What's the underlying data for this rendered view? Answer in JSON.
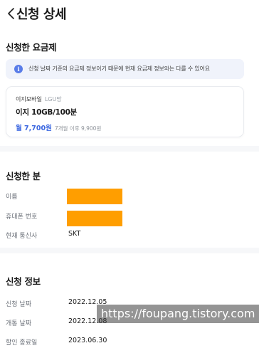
{
  "header": {
    "back_icon": "chevron-left-icon",
    "title": "신청 상세"
  },
  "plan_section": {
    "title": "신청한 요금제",
    "notice": {
      "icon": "info-icon",
      "icon_glyph": "i",
      "text": "신청 날짜 기준의 요금제 정보이기 때문에 현재 요금제 정보와는 다를 수 있어요"
    },
    "card": {
      "carrier": "이지모바일",
      "network": "LGU망",
      "plan_name": "이지 10GB/100분",
      "price": "월 7,700원",
      "after_price": "7개월 이후 9,900원"
    }
  },
  "applicant_section": {
    "title": "신청한 분",
    "rows": [
      {
        "label": "이름",
        "value": ""
      },
      {
        "label": "휴대폰 번호",
        "value": ""
      },
      {
        "label": "현재 통신사",
        "value": "SKT"
      }
    ]
  },
  "application_section": {
    "title": "신청 정보",
    "rows": [
      {
        "label": "신청 날짜",
        "value": "2022.12.05"
      },
      {
        "label": "개통 날짜",
        "value": "2022.12.08"
      },
      {
        "label": "할인 종료일",
        "value": "2023.06.30"
      }
    ]
  },
  "watermark": "https://foupang.tistory.com",
  "colors": {
    "accent": "#3a66e0",
    "info_icon": "#5a7de8",
    "redaction": "#ff9e00",
    "notice_bg": "#f0f3fb"
  }
}
